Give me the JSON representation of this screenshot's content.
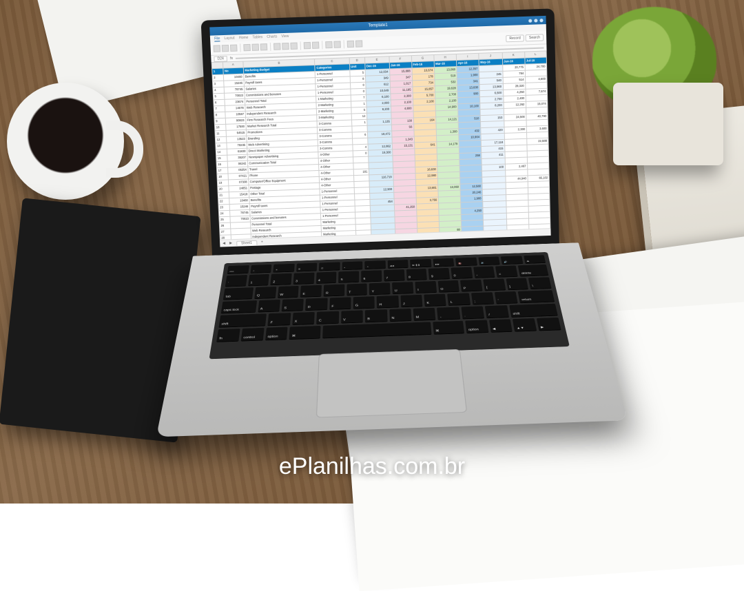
{
  "watermark": "ePlanilhas.com.br",
  "app": {
    "title": "Template1",
    "tabs": [
      "File",
      "Layout",
      "Home",
      "Tables",
      "Charts",
      "View"
    ],
    "active_tab": "File",
    "cell_ref": "D24",
    "sheet_tab": "Sheet1",
    "ribbon": {
      "record": "Record",
      "search": "Search"
    }
  },
  "columns": [
    "",
    "A",
    "B",
    "C",
    "D",
    "E",
    "F",
    "G",
    "H",
    "I",
    "J",
    "K",
    "L"
  ],
  "header": {
    "no": "No",
    "title": "Marketing Budget",
    "categories": "Categories",
    "unit": "Unit",
    "months": [
      "Dec-15",
      "Jan-16",
      "Feb-16",
      "Mar-16",
      "Apr-16",
      "May-16",
      "Jun-16",
      "Jul-16"
    ]
  },
  "rows": [
    {
      "r": 2,
      "no": "10460",
      "name": "Benefits",
      "cat": "1-Personnel",
      "unit": "5",
      "v": [
        "12,034",
        "15,888",
        "10,674",
        "13,060",
        "12,357",
        "",
        "20,775",
        "24,700"
      ]
    },
    {
      "r": 3,
      "no": "15246",
      "name": "Payroll taxes",
      "cat": "1-Personnel",
      "unit": "8",
      "v": [
        "349",
        "347",
        "178",
        "519",
        "1,900",
        "245",
        "784",
        ""
      ]
    },
    {
      "r": 4,
      "no": "78745",
      "name": "Salaries",
      "cat": "1-Personnel",
      "unit": "0",
      "v": [
        "612",
        "1,017",
        "734",
        "532",
        "341",
        "540",
        "514",
        "4,600"
      ]
    },
    {
      "r": 5,
      "no": "70023",
      "name": "Commissions and bonuses",
      "cat": "1-Personnel",
      "unit": "0",
      "v": [
        "10,649",
        "11,195",
        "15,857",
        "19,628",
        "13,630",
        "13,960",
        "28,320",
        ""
      ]
    },
    {
      "r": 6,
      "no": "23674",
      "name": "Personnel Total",
      "cat": "1-Marketing",
      "unit": "7",
      "v": [
        "6,100",
        "2,300",
        "5,700",
        "2,700",
        "900",
        "6,500",
        "4,250",
        "7,674"
      ]
    },
    {
      "r": 7,
      "no": "14678",
      "name": "Web Research",
      "cat": "2-Marketing",
      "unit": "1",
      "v": [
        "2,000",
        "2,100",
        "2,100",
        "2,100",
        "",
        "2,700",
        "2,400",
        ""
      ]
    },
    {
      "r": 8,
      "no": "10567",
      "name": "Independent Research",
      "cat": "2-Marketing",
      "unit": "5",
      "v": [
        "8,200",
        "4,800",
        "",
        "14,900",
        "10,100",
        "8,200",
        "12,262",
        "15,074"
      ]
    },
    {
      "r": 9,
      "no": "90823",
      "name": "Firm Research Fees",
      "cat": "3-Marketing",
      "unit": "12",
      "v": [
        "",
        "",
        "",
        "",
        "",
        "",
        "",
        ""
      ]
    },
    {
      "r": 10,
      "no": "17500",
      "name": "Market Research Total",
      "cat": "3-Comms",
      "unit": "1",
      "v": [
        "1,135",
        "130",
        "164",
        "14,121",
        "510",
        "153",
        "24,500",
        "40,790"
      ]
    },
    {
      "r": 11,
      "no": "64515",
      "name": "Promotions",
      "cat": "3-Comms",
      "unit": "",
      "v": [
        "",
        "56",
        "",
        "",
        "",
        "",
        "",
        ""
      ]
    },
    {
      "r": 12,
      "no": "13523",
      "name": "Branding",
      "cat": "3-Comms",
      "unit": "6",
      "v": [
        "18,472",
        "",
        "",
        "1,300",
        "432",
        "420",
        "2,300",
        "3,600"
      ]
    },
    {
      "r": 13,
      "no": "78235",
      "name": "Web Advertising",
      "cat": "3-Comms",
      "unit": "",
      "v": [
        "",
        "1,343",
        "",
        "",
        "10,904",
        "",
        "",
        ""
      ]
    },
    {
      "r": 14,
      "no": "61830",
      "name": "Direct Marketing",
      "cat": "3-Comms",
      "unit": "4",
      "v": [
        "12,862",
        "15,131",
        "641",
        "14,179",
        "",
        "17,118",
        "",
        "22,588"
      ]
    },
    {
      "r": 15,
      "no": "35207",
      "name": "Newspaper Advertising",
      "cat": "4-Other",
      "unit": "0",
      "v": [
        "19,300",
        "",
        "",
        "",
        "",
        "415",
        "",
        ""
      ]
    },
    {
      "r": 16,
      "no": "06342",
      "name": "Communication Total",
      "cat": "4-Other",
      "unit": "",
      "v": [
        "",
        "",
        "",
        "",
        "258",
        "411",
        "",
        ""
      ]
    },
    {
      "r": 17,
      "no": "05354",
      "name": "Travel",
      "cat": "4-Other",
      "unit": "",
      "v": [
        "",
        "",
        "",
        "",
        "",
        "",
        "",
        ""
      ]
    },
    {
      "r": 18,
      "no": "07421",
      "name": "Phone",
      "cat": "4-Other",
      "unit": "181",
      "v": [
        "",
        "",
        "16,630",
        "",
        "",
        "100",
        "2,467",
        ""
      ]
    },
    {
      "r": 19,
      "no": "07308",
      "name": "Computer/Office Equipment",
      "cat": "4-Other",
      "unit": "",
      "v": [
        "116,719",
        "",
        "12,980",
        "",
        "",
        "",
        "",
        ""
      ]
    },
    {
      "r": 20,
      "no": "24851",
      "name": "Postage",
      "cat": "4-Other",
      "unit": "",
      "v": [
        "",
        "",
        "",
        "",
        "",
        "",
        "44,940",
        "65,102"
      ]
    },
    {
      "r": 21,
      "no": "15418",
      "name": "Other Total",
      "cat": "1-Personnel",
      "unit": "",
      "v": [
        "12,900",
        "",
        "13,681",
        "13,060",
        "12,580",
        "",
        "",
        ""
      ]
    },
    {
      "r": 22,
      "no": "10460",
      "name": "Benefits",
      "cat": "1-Personnel",
      "unit": "",
      "v": [
        "",
        "",
        "",
        "",
        "20,246",
        "",
        "",
        ""
      ]
    },
    {
      "r": 23,
      "no": "15246",
      "name": "Payroll taxes",
      "cat": "1-Personnel",
      "unit": "",
      "v": [
        "454",
        "",
        "3,756",
        "",
        "1,900",
        "",
        "",
        ""
      ]
    },
    {
      "r": 24,
      "no": "78745",
      "name": "Salaries",
      "cat": "1-Personnel",
      "unit": "",
      "v": [
        "",
        "41,250",
        "",
        "",
        "",
        "",
        "",
        ""
      ]
    },
    {
      "r": 25,
      "no": "70023",
      "name": "Commissions and bonuses",
      "cat": "1-Personnel",
      "unit": "",
      "v": [
        "",
        "",
        "",
        "",
        "4,250",
        "",
        "",
        ""
      ]
    },
    {
      "r": 26,
      "no": "",
      "name": "Personnel Total",
      "cat": "Marketing",
      "unit": "",
      "v": [
        "",
        "",
        "",
        "",
        "",
        "",
        "",
        ""
      ]
    },
    {
      "r": 27,
      "no": "",
      "name": "Web Research",
      "cat": "Marketing",
      "unit": "",
      "v": [
        "",
        "",
        "",
        "",
        "",
        "",
        "",
        ""
      ]
    },
    {
      "r": 28,
      "no": "",
      "name": "Independent Research",
      "cat": "Marketing",
      "unit": "",
      "v": [
        "",
        "",
        "",
        "80",
        "",
        "",
        "",
        ""
      ]
    }
  ],
  "keyboard": {
    "fn": [
      "esc",
      "☼",
      "☀",
      "⊞",
      "⊟",
      "◐",
      "◑",
      "◀◀",
      "▶/❚❚",
      "▶▶",
      "🔇",
      "🔉",
      "🔊",
      "⏏"
    ],
    "r1": [
      "`",
      "1",
      "2",
      "3",
      "4",
      "5",
      "6",
      "7",
      "8",
      "9",
      "0",
      "-",
      "=",
      "delete"
    ],
    "r2": [
      "tab",
      "Q",
      "W",
      "E",
      "R",
      "T",
      "Y",
      "U",
      "I",
      "O",
      "P",
      "[",
      "]",
      "\\"
    ],
    "r3": [
      "caps lock",
      "A",
      "S",
      "D",
      "F",
      "G",
      "H",
      "J",
      "K",
      "L",
      ";",
      "'",
      "return"
    ],
    "r4": [
      "shift",
      "Z",
      "X",
      "C",
      "V",
      "B",
      "N",
      "M",
      ",",
      ".",
      "/",
      "shift"
    ],
    "r5": [
      "fn",
      "control",
      "option",
      "⌘",
      " ",
      "⌘",
      "option",
      "◀",
      "▲▼",
      "▶"
    ]
  }
}
